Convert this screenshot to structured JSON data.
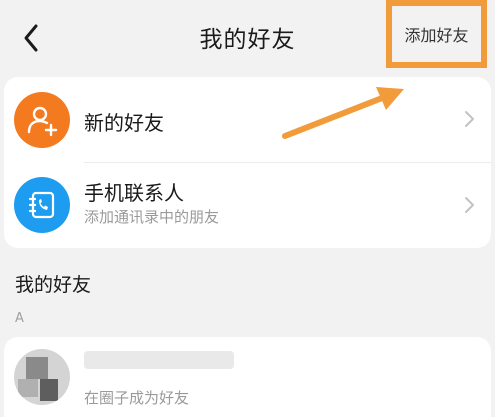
{
  "header": {
    "title": "我的好友",
    "add_friend_label": "添加好友"
  },
  "entries": [
    {
      "label": "新的好友",
      "icon": "add-user-icon",
      "color": "#f47a1f"
    },
    {
      "label": "手机联系人",
      "subtitle": "添加通讯录中的朋友",
      "icon": "phone-contacts-icon",
      "color": "#1e9cf0"
    }
  ],
  "friends_section": {
    "title": "我的好友",
    "index_letter": "A",
    "items": [
      {
        "subtitle": "在圈子成为好友"
      }
    ]
  },
  "annotation": {
    "highlight_color": "#f29b3a"
  }
}
